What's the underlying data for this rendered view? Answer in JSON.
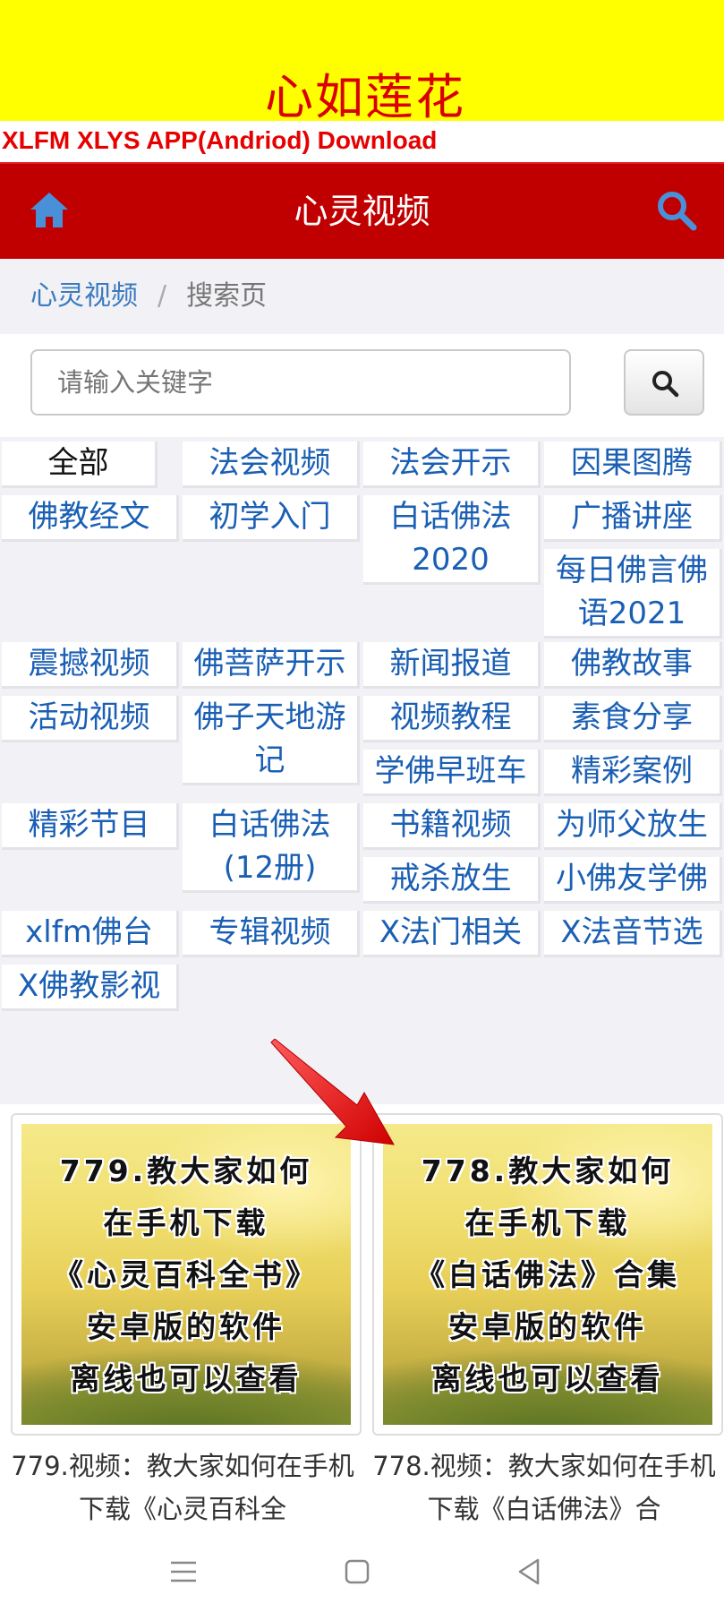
{
  "banner": {
    "title": "心如莲花",
    "app_link": "XLFM XLYS APP(Andriod) Download"
  },
  "navbar": {
    "title": "心灵视频",
    "home_icon": "home-icon",
    "search_icon": "search-icon",
    "colors": {
      "background": "#c00000",
      "icon": "#4a90d9"
    }
  },
  "breadcrumb": {
    "home": "心灵视频",
    "separator": "/",
    "current": "搜索页"
  },
  "search": {
    "placeholder": "请输入关键字",
    "button_icon": "search-icon"
  },
  "categories": [
    "全部",
    "法会视频",
    "法会开示",
    "因果图腾",
    "佛教经文",
    "初学入门",
    "白话佛法2020",
    "广播讲座",
    "每日佛言佛语2021",
    "震撼视频",
    "佛菩萨开示",
    "新闻报道",
    "佛教故事",
    "活动视频",
    "佛子天地游记",
    "视频教程",
    "素食分享",
    "学佛早班车",
    "精彩案例",
    "精彩节目",
    "白话佛法(12册)",
    "书籍视频",
    "为师父放生",
    "戒杀放生",
    "小佛友学佛",
    "xlfm佛台",
    "专辑视频",
    "X法门相关",
    "X法音节选",
    "X佛教影视"
  ],
  "active_category": "全部",
  "videos": [
    {
      "thumb_lines": [
        "779.教大家如何",
        "在手机下载",
        "《心灵百科全书》",
        "安卓版的软件",
        "离线也可以查看"
      ],
      "caption": "779.视频：教大家如何在手机下载《心灵百科全"
    },
    {
      "thumb_lines": [
        "778.教大家如何",
        "在手机下载",
        "《白话佛法》合集",
        "安卓版的软件",
        "离线也可以查看"
      ],
      "caption": "778.视频：教大家如何在手机下载《白话佛法》合"
    }
  ],
  "system_nav": {
    "menu_icon": "menu-lines-icon",
    "home_icon": "square-home-icon",
    "back_icon": "triangle-back-icon"
  }
}
